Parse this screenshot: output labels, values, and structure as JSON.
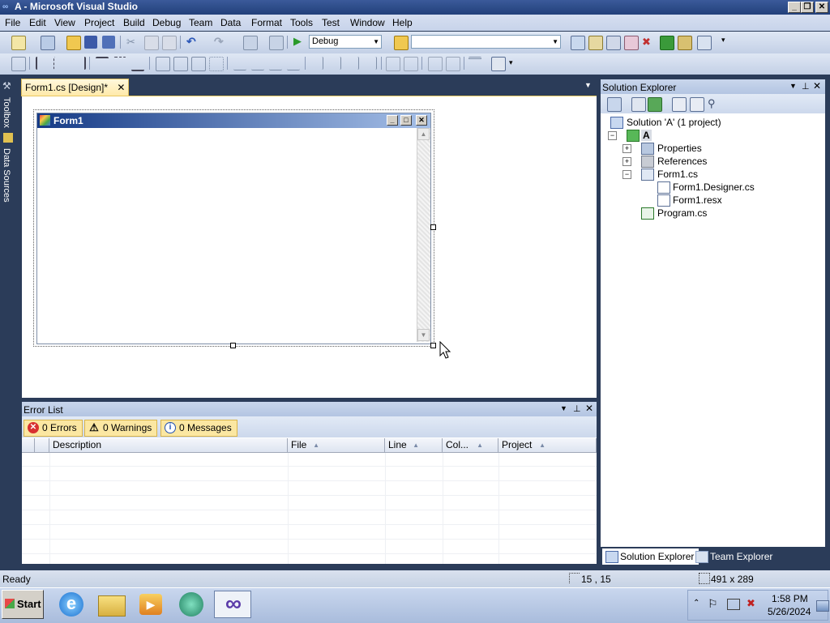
{
  "window": {
    "title": "A - Microsoft Visual Studio"
  },
  "menu": [
    "File",
    "Edit",
    "View",
    "Project",
    "Build",
    "Debug",
    "Team",
    "Data",
    "Format",
    "Tools",
    "Test",
    "Window",
    "Help"
  ],
  "toolbar": {
    "config_combo": "Debug",
    "platform_combo": ""
  },
  "side_tabs": {
    "toolbox": "Toolbox",
    "data_sources": "Data Sources"
  },
  "document": {
    "tab_label": "Form1.cs [Design]*",
    "form_caption": "Form1"
  },
  "error_list": {
    "title": "Error List",
    "errors_btn": "0 Errors",
    "warnings_btn": "0 Warnings",
    "messages_btn": "0 Messages",
    "columns": [
      "Description",
      "File",
      "Line",
      "Col...",
      "Project"
    ]
  },
  "solution_explorer": {
    "title": "Solution Explorer",
    "solution": "Solution 'A' (1 project)",
    "project": "A",
    "properties": "Properties",
    "references": "References",
    "form_file": "Form1.cs",
    "designer_file": "Form1.Designer.cs",
    "resx_file": "Form1.resx",
    "program_file": "Program.cs",
    "footer_solution_tab": "Solution Explorer",
    "footer_team_tab": "Team Explorer"
  },
  "status": {
    "text": "Ready",
    "position": "15 , 15",
    "size": "491 x 289"
  },
  "taskbar": {
    "start": "Start",
    "time": "1:58 PM",
    "date": "5/26/2024"
  },
  "colors": {
    "accent": "#2b3c59",
    "selection_tab": "#ffe9a8",
    "title_gradient": "#153a86"
  }
}
